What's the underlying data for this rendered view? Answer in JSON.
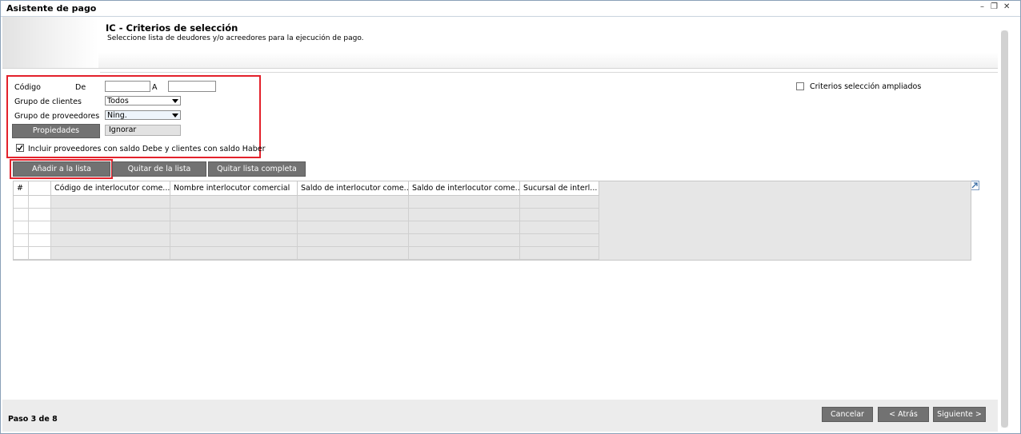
{
  "window": {
    "title": "Asistente de pago",
    "minimize_glyph": "–",
    "restore_glyph": "❐",
    "close_glyph": "✕"
  },
  "header": {
    "title": "IC - Criterios de selección",
    "subtitle": "Seleccione lista de deudores y/o acreedores para la ejecución de pago."
  },
  "criteria": {
    "codigo_label": "Código",
    "de_label": "De",
    "a_label": "A",
    "codigo_de_value": "",
    "codigo_a_value": "",
    "grupo_clientes_label": "Grupo de clientes",
    "grupo_clientes_value": "Todos",
    "grupo_proveedores_label": "Grupo de proveedores",
    "grupo_proveedores_value": "Ning.",
    "propiedades_button": "Propiedades",
    "ignorar_value": "Ignorar",
    "incluir_label": "Incluir proveedores con saldo Debe y clientes con saldo Haber",
    "incluir_checked": true,
    "ampliados_label": "Criterios selección ampliados",
    "ampliados_checked": false
  },
  "list_buttons": {
    "add": "Añadir a la lista",
    "remove": "Quitar de la lista",
    "remove_all": "Quitar lista completa"
  },
  "grid": {
    "columns": [
      "#",
      "",
      "Código de interlocutor come...",
      "Nombre interlocutor comercial",
      "Saldo de interlocutor come...",
      "Saldo de interlocutor come...",
      "Sucursal de interl..."
    ],
    "rows": 5
  },
  "footer": {
    "step": "Paso 3 de 8",
    "cancel": "Cancelar",
    "back": "< Atrás",
    "next": "Siguiente >"
  },
  "colors": {
    "highlight_box": "#e3212b",
    "button_bg": "#727272"
  }
}
